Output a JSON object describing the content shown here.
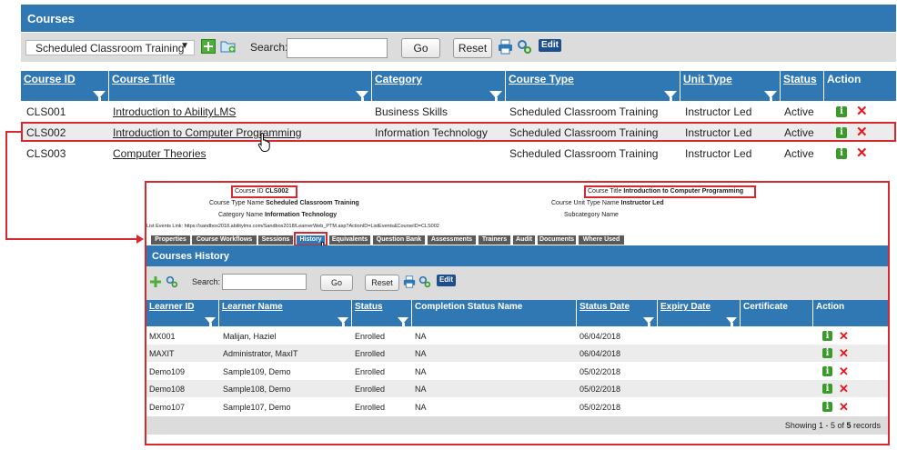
{
  "header": {
    "title": "Courses"
  },
  "toolbar": {
    "select_value": "Scheduled Classroom Training",
    "search_label": "Search:",
    "search_value": "",
    "go_label": "Go",
    "reset_label": "Reset",
    "edit_label": "Edit"
  },
  "table": {
    "columns": [
      "Course ID",
      "Course Title",
      "Category",
      "Course Type",
      "Unit Type",
      "Status",
      "Action"
    ],
    "rows": [
      [
        "CLS001",
        "Introduction to AbilityLMS",
        "Business Skills",
        "Scheduled Classroom Training",
        "Instructor Led",
        "Active"
      ],
      [
        "CLS002",
        "Introduction to Computer Programming",
        "Information Technology",
        "Scheduled Classroom Training",
        "Instructor Led",
        "Active"
      ],
      [
        "CLS003",
        "Computer Theories",
        "",
        "Scheduled Classroom Training",
        "Instructor Led",
        "Active"
      ]
    ]
  },
  "detail": {
    "course_id_label": "Course ID",
    "course_id_value": "CLS002",
    "course_title_label": "Course Title",
    "course_title_value": "Introduction to Computer Programming",
    "course_type_label": "Course Type Name",
    "course_type_value": "Scheduled Classroom Training",
    "unit_type_label": "Course Unit Type Name",
    "unit_type_value": "Instructor Led",
    "category_label": "Category Name",
    "category_value": "Information Technology",
    "subcategory_label": "Subcategory Name",
    "link_text": "List Events Link: https://sandbox2018.abilitylms.com/Sandbox2018/LearnerWeb_PTM.asp?ActionID=ListEvents&CourseID=CLS002",
    "tabs": [
      "Properties",
      "Course Workflows",
      "Sessions",
      "History",
      "Equivalents",
      "Question Bank",
      "Assessments",
      "Trainers",
      "Audit",
      "Documents",
      "Where Used"
    ]
  },
  "history": {
    "title": "Courses History",
    "search_label": "Search:",
    "go_label": "Go",
    "reset_label": "Reset",
    "edit_label": "Edit",
    "columns": [
      "Learner ID",
      "Learner Name",
      "Status",
      "Completion Status Name",
      "Status Date",
      "Expiry Date",
      "Certificate",
      "Action"
    ],
    "rows": [
      [
        "MX001",
        "Malijan, Haziel",
        "Enrolled",
        "NA",
        "06/04/2018"
      ],
      [
        "MAXIT",
        "Administrator, MaxIT",
        "Enrolled",
        "NA",
        "06/04/2018"
      ],
      [
        "Demo109",
        "Sample109, Demo",
        "Enrolled",
        "NA",
        "05/02/2018"
      ],
      [
        "Demo108",
        "Sample108, Demo",
        "Enrolled",
        "NA",
        "05/02/2018"
      ],
      [
        "Demo107",
        "Sample107, Demo",
        "Enrolled",
        "NA",
        "05/02/2018"
      ]
    ],
    "footer_prefix": "Showing 1 - 5 of ",
    "footer_total": "5",
    "footer_suffix": " records"
  },
  "colors": {
    "accent": "#2f78b4",
    "highlight": "#d7272f",
    "info": "#3a9a2a",
    "delete": "#e8151c",
    "toolbar": "#dcdcdc"
  }
}
